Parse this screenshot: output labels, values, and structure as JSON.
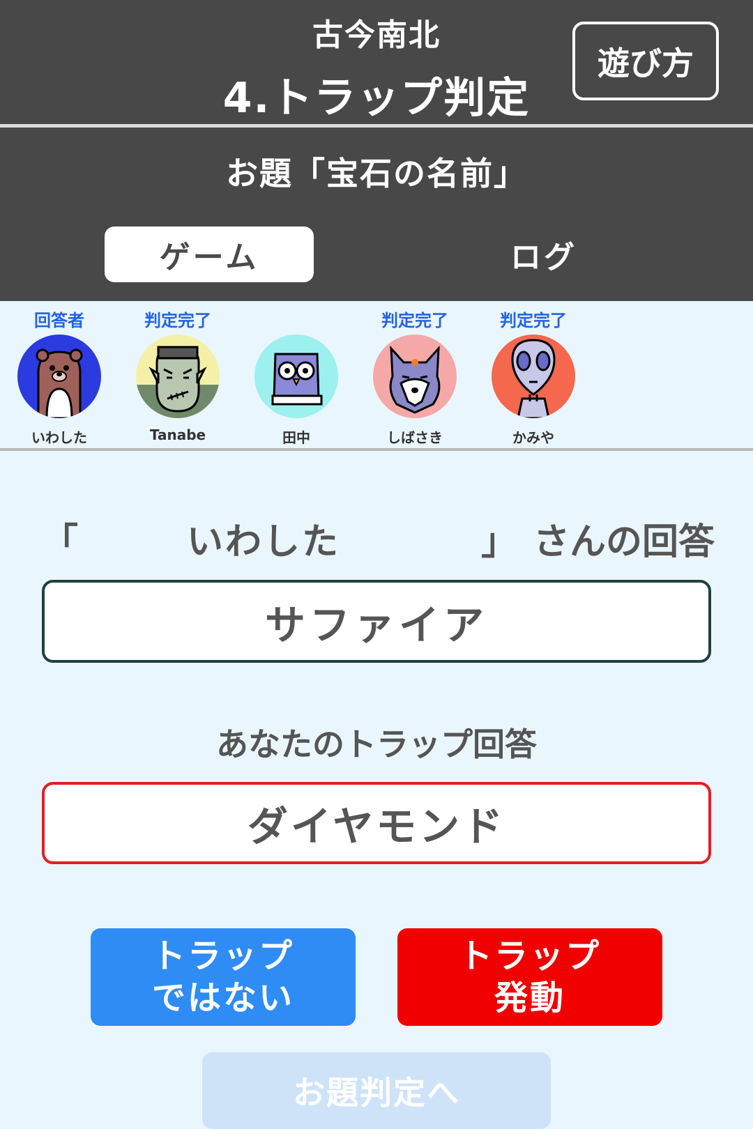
{
  "header": {
    "app_title": "古今南北",
    "phase_title": "4.トラップ判定",
    "howto_label": "遊び方"
  },
  "topic": {
    "text": "お題「宝石の名前」"
  },
  "tabs": [
    {
      "label": "ゲーム",
      "active": true
    },
    {
      "label": "ログ",
      "active": false
    }
  ],
  "players": [
    {
      "status": "回答者",
      "name": "いわした",
      "avatar_icon": "bear-icon",
      "bg_color": "#2b3be0"
    },
    {
      "status": "判定完了",
      "name": "Tanabe",
      "avatar_icon": "zombie-icon",
      "bg_color": "#f5f0a8"
    },
    {
      "status": "",
      "name": "田中",
      "avatar_icon": "owl-book-icon",
      "bg_color": "#9cf0ee"
    },
    {
      "status": "判定完了",
      "name": "しばさき",
      "avatar_icon": "wolf-icon",
      "bg_color": "#f5a8a8"
    },
    {
      "status": "判定完了",
      "name": "かみや",
      "avatar_icon": "alien-icon",
      "bg_color": "#f5684e"
    }
  ],
  "answer": {
    "open_quote": "「",
    "respondent": "いわした",
    "close_quote": "」",
    "suffix": "さんの回答",
    "value": "サファイア"
  },
  "trap": {
    "label": "あなたのトラップ回答",
    "value": "ダイヤモンド"
  },
  "buttons": {
    "not_trap_line1": "トラップ",
    "not_trap_line2": "ではない",
    "trap_line1": "トラップ",
    "trap_line2": "発動",
    "next": "お題判定へ"
  },
  "colors": {
    "header_bg": "#484848",
    "page_bg": "#eaf6fd",
    "status_text": "#2463e0",
    "not_trap_button": "#2f8cf5",
    "trap_button": "#f00000",
    "trap_border": "#e02020"
  }
}
